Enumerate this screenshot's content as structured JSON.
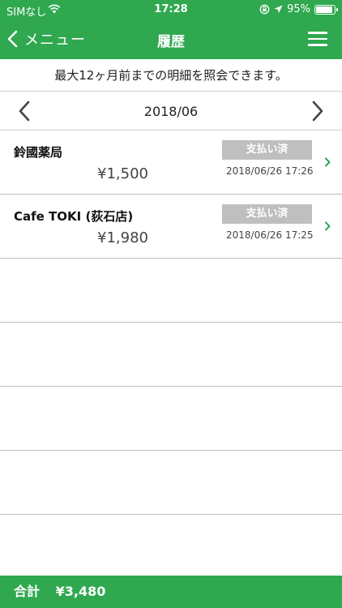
{
  "status_bar": {
    "carrier": "SIMなし",
    "time": "17:28",
    "battery": "95%"
  },
  "nav": {
    "back_label": "メニュー",
    "title": "履歴"
  },
  "notice": "最大12ヶ月前までの明細を照会できます。",
  "month": "2018/06",
  "transactions": [
    {
      "name": "鈴國薬局",
      "amount": "¥1,500",
      "status": "支払い済",
      "datetime": "2018/06/26 17:26"
    },
    {
      "name": "Cafe TOKI (荻石店)",
      "amount": "¥1,980",
      "status": "支払い済",
      "datetime": "2018/06/26 17:25"
    }
  ],
  "footer": {
    "total_label": "合計",
    "total_value": "¥3,480"
  },
  "colors": {
    "brand_green": "#2fa84f",
    "badge_gray": "#bfbfbf",
    "chevron_green": "#2fa84f"
  }
}
